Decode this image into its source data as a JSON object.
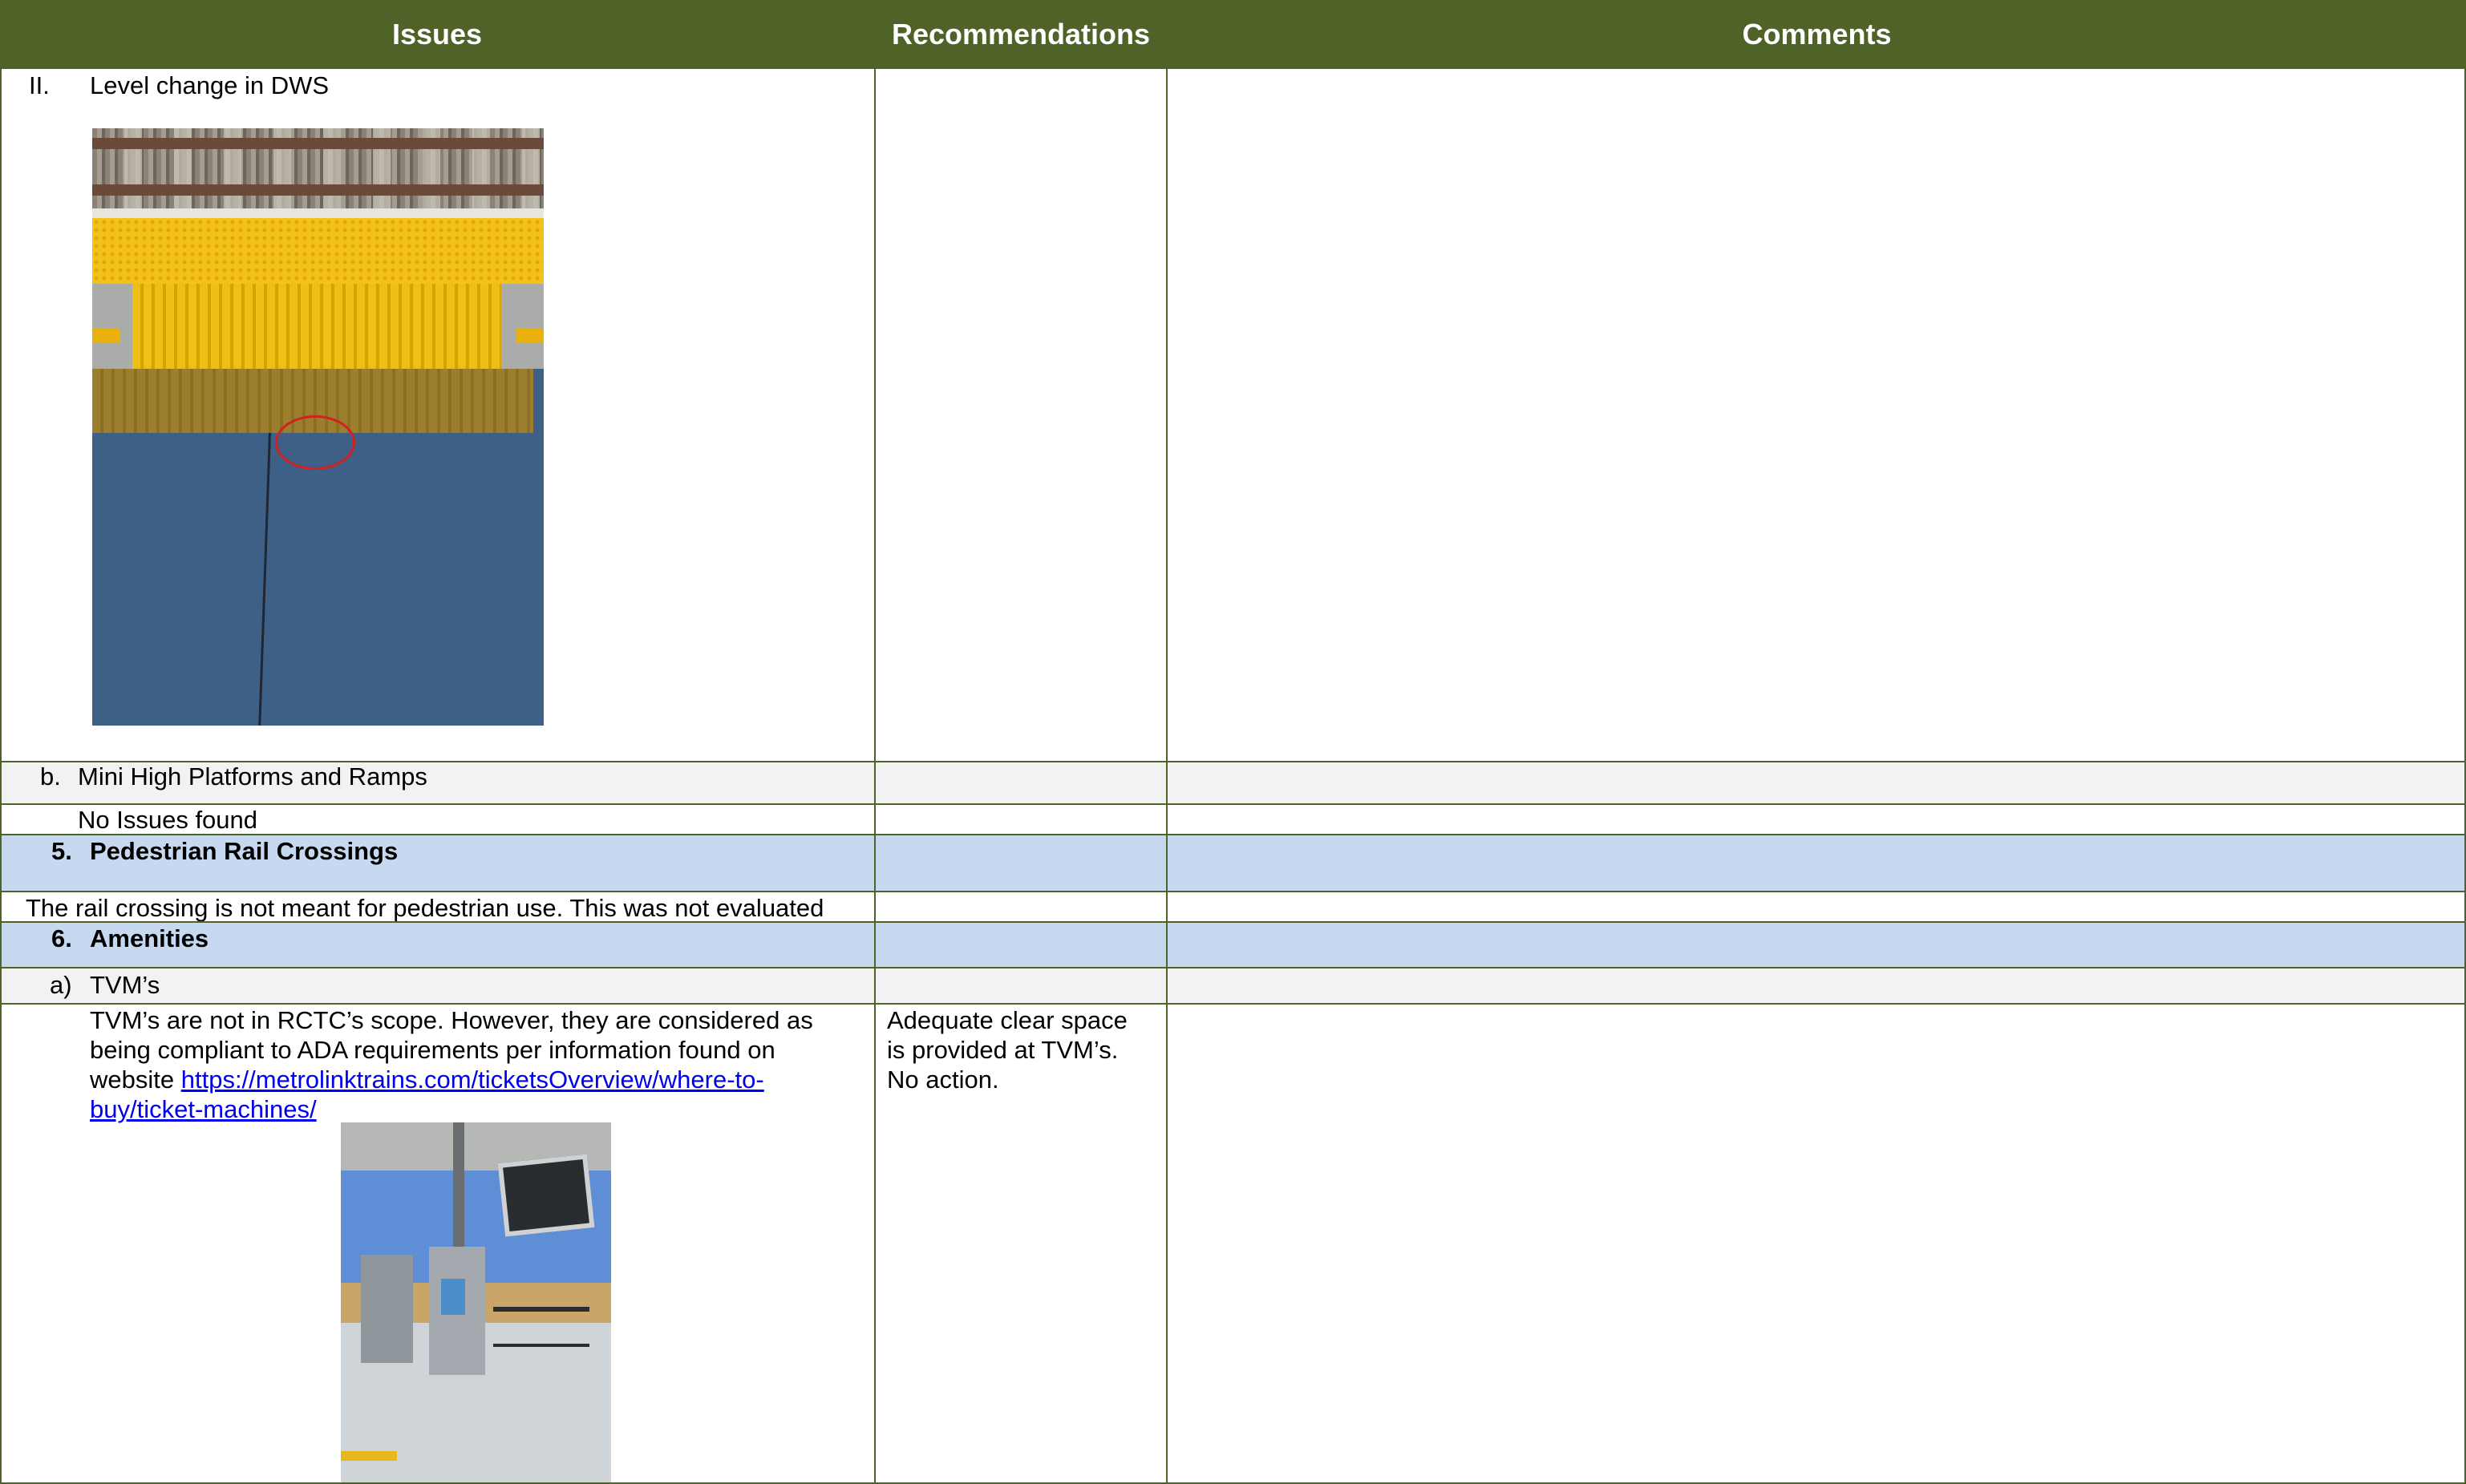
{
  "header": {
    "issues": "Issues",
    "recommendations": "Recommendations",
    "comments": "Comments"
  },
  "rows": {
    "level_change": {
      "marker": "II.",
      "title": "Level change in DWS"
    },
    "mini_high": {
      "marker": "b.",
      "title": "Mini High Platforms and Ramps"
    },
    "no_issues": "No Issues found",
    "ped_crossings": {
      "marker": "5.",
      "title": "Pedestrian Rail Crossings"
    },
    "rail_note": "The rail crossing is not meant for pedestrian use. This was not evaluated",
    "amenities": {
      "marker": "6.",
      "title": "Amenities"
    },
    "tvms": {
      "marker": "a)",
      "title": "TVM’s"
    },
    "tvm_text_1": "TVM’s are not in RCTC’s scope. However, they are considered as",
    "tvm_text_2": "being compliant to ADA requirements per information found on",
    "tvm_text_3_prefix": "website ",
    "tvm_link_1": "https://metrolinktrains.com/ticketsOverview/where-to-",
    "tvm_link_2": "buy/ticket-machines/",
    "tvm_recommendation_1": "Adequate clear space",
    "tvm_recommendation_2": "is provided at TVM’s.",
    "tvm_recommendation_3": "No action."
  },
  "images": {
    "photo1": "photo-tactile-warning-strip",
    "photo2": "photo-tvm-station"
  },
  "colors": {
    "header_bg": "#4f6228",
    "section_blue": "#c6d9f1",
    "subsection_grey": "#f2f2f2",
    "link": "#0000ee",
    "annotation_red": "#d32020"
  }
}
